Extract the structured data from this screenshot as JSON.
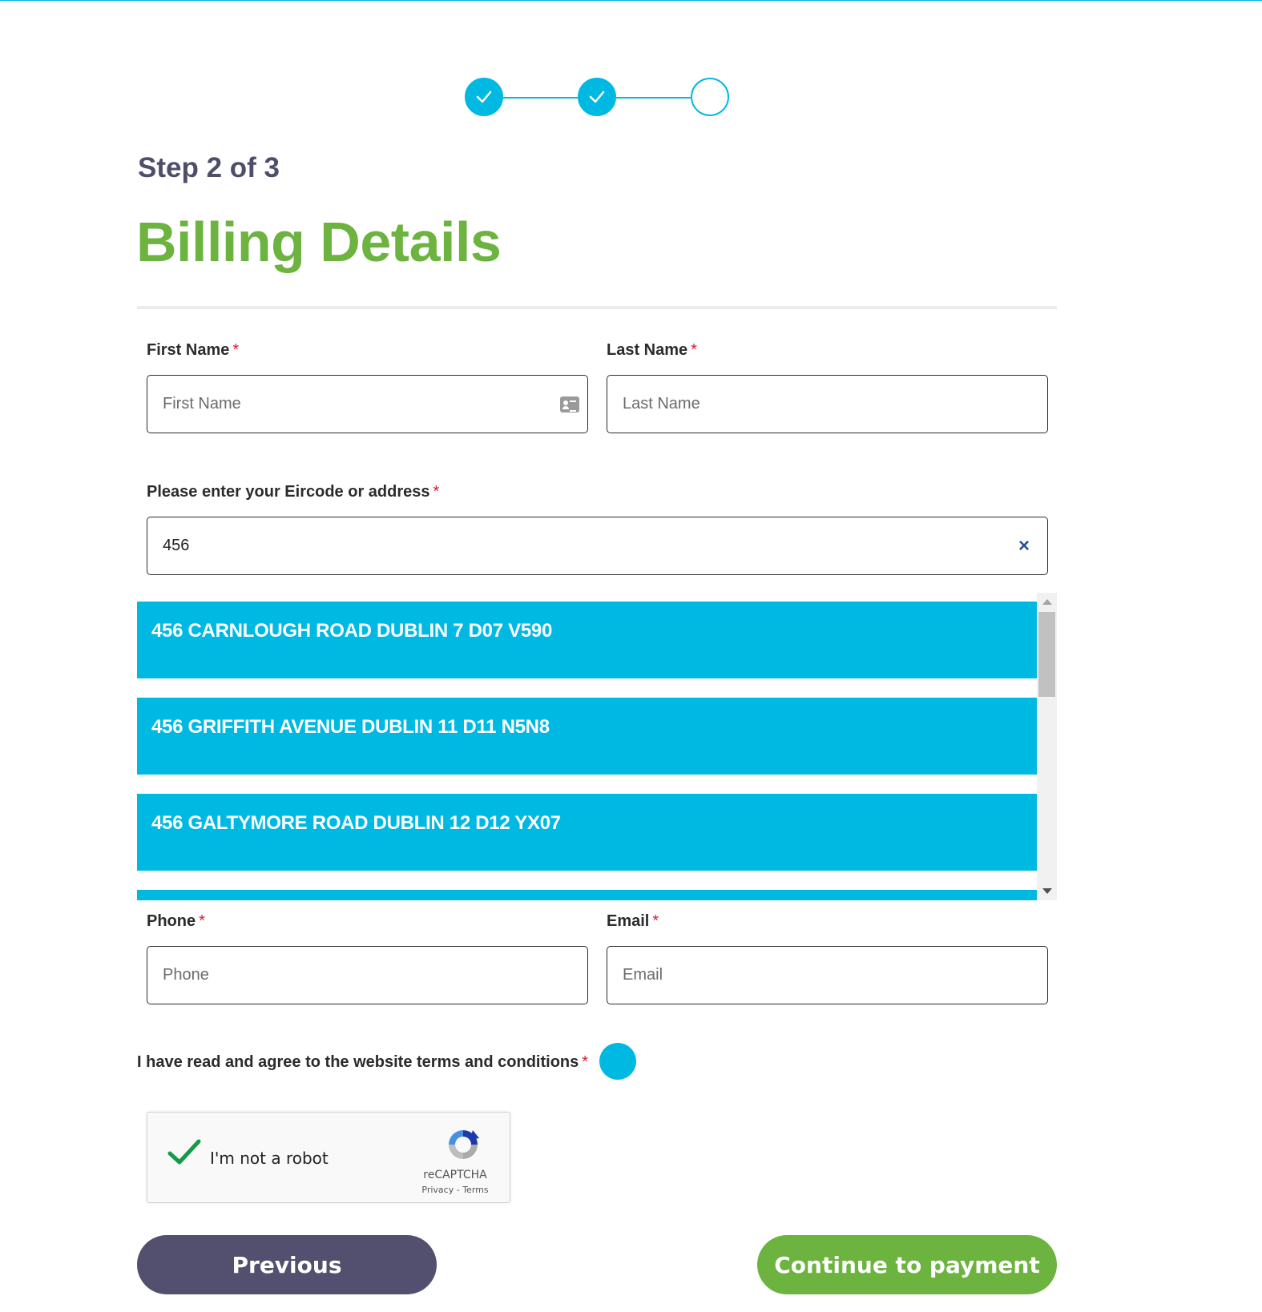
{
  "colors": {
    "accent": "#00b9e3",
    "brand_green": "#6db33f",
    "dark_purple": "#52506e",
    "required": "#d21f2f"
  },
  "progress": {
    "steps": [
      "complete",
      "complete",
      "incomplete"
    ]
  },
  "header": {
    "step_text": "Step 2 of 3",
    "title": "Billing Details"
  },
  "form": {
    "required_marker": "*",
    "first_name": {
      "label": "First Name",
      "placeholder": "First Name",
      "icon": "contact-card-icon"
    },
    "last_name": {
      "label": "Last Name",
      "placeholder": "Last Name"
    },
    "address": {
      "label": "Please enter your Eircode or address",
      "value": "456",
      "clear_icon": "×"
    },
    "suggestions": [
      "456 CARNLOUGH ROAD DUBLIN 7 D07 V590",
      "456 GRIFFITH AVENUE DUBLIN 11 D11 N5N8",
      "456 GALTYMORE ROAD DUBLIN 12 D12 YX07"
    ],
    "phone": {
      "label": "Phone",
      "placeholder": "Phone"
    },
    "email": {
      "label": "Email",
      "placeholder": "Email"
    },
    "terms": {
      "label": "I have read and agree to the website terms and conditions"
    }
  },
  "recaptcha": {
    "label": "I'm not a robot",
    "brand": "reCAPTCHA",
    "links": "Privacy - Terms",
    "checked": true
  },
  "buttons": {
    "previous": "Previous",
    "continue": "Continue to payment"
  }
}
